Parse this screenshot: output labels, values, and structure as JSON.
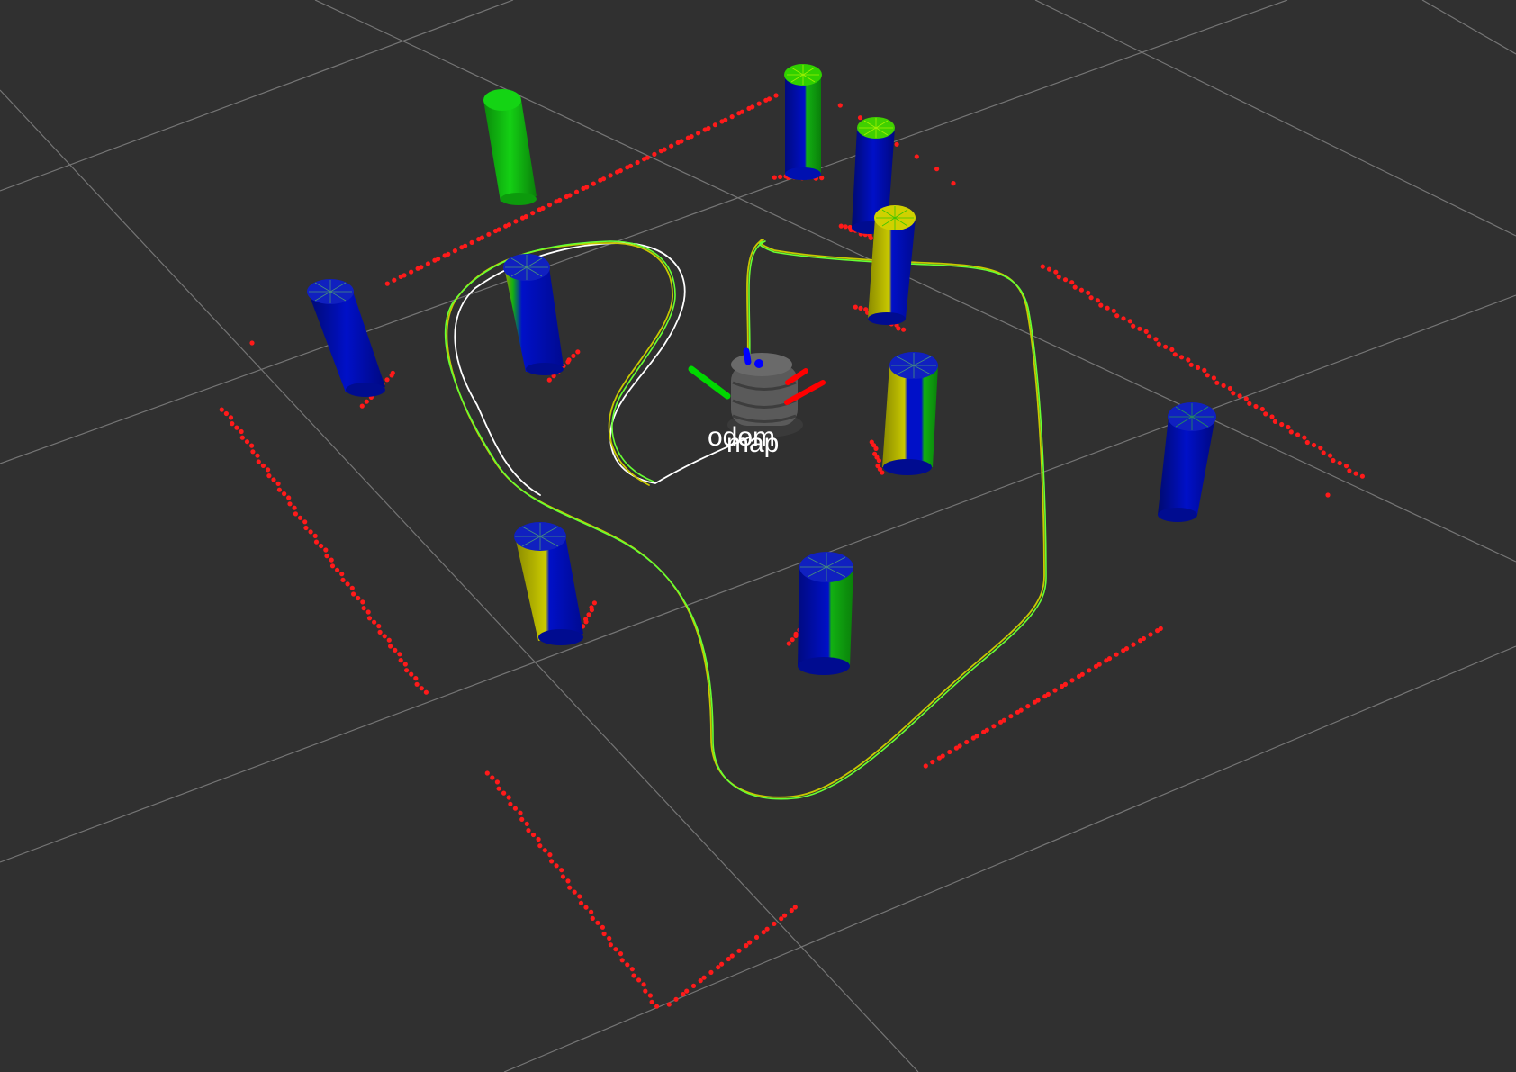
{
  "viewport": {
    "background": "#303030",
    "grid_color": "#a0a0a0"
  },
  "labels": {
    "frame_odom": "odom",
    "frame_map": "map"
  },
  "colors": {
    "scan_points": "#ff0000",
    "path_odom": "#ffffff",
    "path_estimate": "#c8c800",
    "path_truth": "#66ff33",
    "pillar_blue": "#0010c8",
    "pillar_green": "#10c010",
    "pillar_yellow": "#c0c000",
    "axis_x": "#ff0000",
    "axis_y": "#00e000",
    "axis_z": "#0000ff",
    "robot": "#555555"
  },
  "icons": {
    "robot": "turtlebot-robot-icon",
    "axes": "tf-axes-icon"
  }
}
